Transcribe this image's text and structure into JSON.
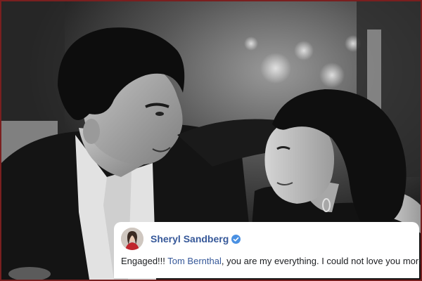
{
  "post": {
    "author": "Sheryl Sandberg",
    "verified_icon": "verified-check-icon",
    "text_before": "Engaged!!! ",
    "mention": "Tom Bernthal",
    "text_after": ", you are my everything. I could not love you more."
  },
  "colors": {
    "name_link": "#365899",
    "verified_badge": "#4a90e2",
    "frame_border": "#7a1f1f",
    "card_background": "#ffffff"
  }
}
